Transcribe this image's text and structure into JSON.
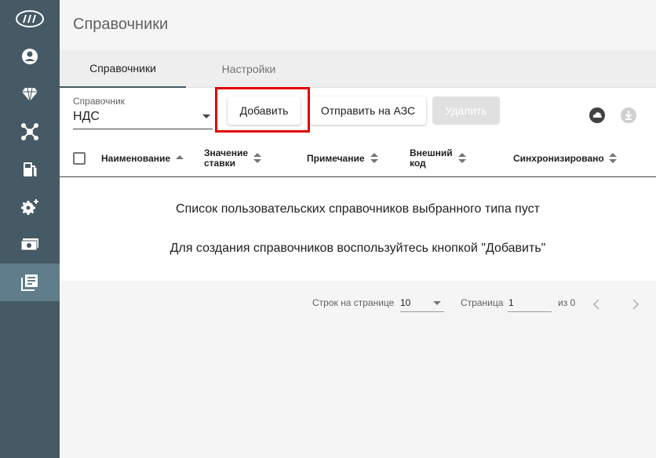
{
  "sidebar": {
    "items": [
      {
        "icon": "logo-icon"
      },
      {
        "icon": "account-circle-icon"
      },
      {
        "icon": "diamond-icon"
      },
      {
        "icon": "network-hub-icon"
      },
      {
        "icon": "fuel-station-icon"
      },
      {
        "icon": "gear-plus-icon"
      },
      {
        "icon": "cash-icon"
      },
      {
        "icon": "dictionary-icon",
        "active": true
      }
    ]
  },
  "header": {
    "title": "Справочники"
  },
  "tabs": [
    {
      "label": "Справочники",
      "active": true
    },
    {
      "label": "Настройки",
      "active": false
    }
  ],
  "toolbar": {
    "selector_label": "Справочник",
    "selector_value": "НДС",
    "add_label": "Добавить",
    "send_label": "Отправить на АЗС",
    "delete_label": "Удалить"
  },
  "table": {
    "columns": [
      {
        "line1": "Наименование",
        "line2": ""
      },
      {
        "line1": "Значение",
        "line2": "ставки"
      },
      {
        "line1": "Примечание",
        "line2": ""
      },
      {
        "line1": "Внешний",
        "line2": "код"
      },
      {
        "line1": "Синхронизировано",
        "line2": ""
      }
    ],
    "empty_message": "Список пользовательских справочников выбранного типа пуст",
    "empty_hint": "Для создания справочников воспользуйтесь кнопкой \"Добавить\""
  },
  "pagination": {
    "rows_label": "Строк на странице",
    "rows_value": "10",
    "page_label": "Страница",
    "page_value": "1",
    "of_label": "из 0"
  },
  "colors": {
    "sidebar_bg": "#455a64",
    "sidebar_active": "#607d8b",
    "highlight": "#e00000"
  }
}
